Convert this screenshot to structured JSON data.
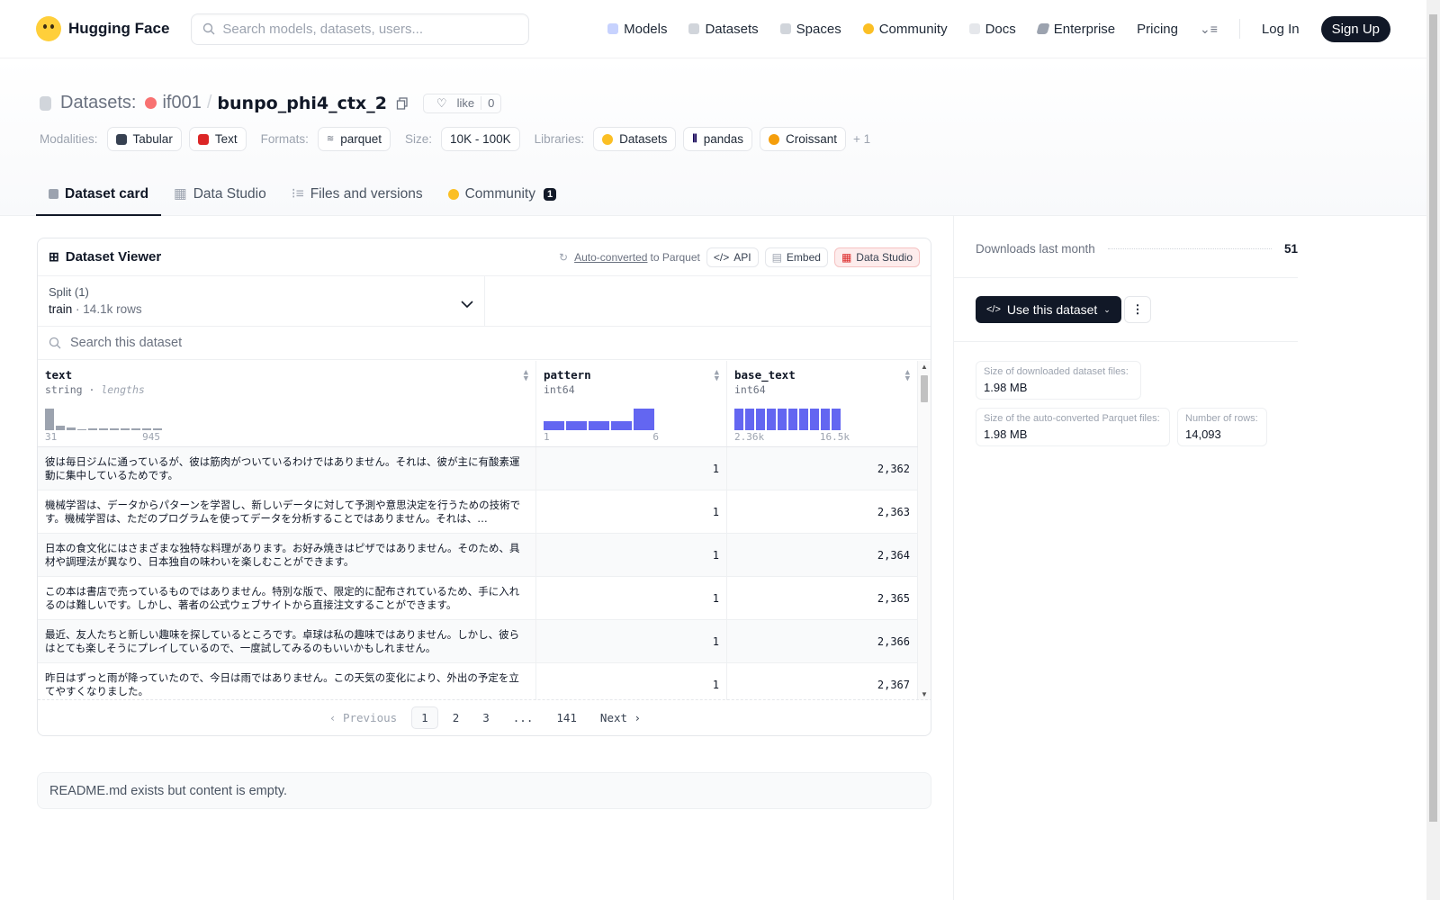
{
  "nav": {
    "brand": "Hugging Face",
    "search_placeholder": "Search models, datasets, users...",
    "links": [
      "Models",
      "Datasets",
      "Spaces",
      "Community",
      "Docs",
      "Enterprise",
      "Pricing"
    ],
    "login": "Log In",
    "signup": "Sign Up"
  },
  "header": {
    "section": "Datasets:",
    "owner": "if001",
    "slash": "/",
    "repo": "bunpo_phi4_ctx_2",
    "like_label": "like",
    "like_count": "0",
    "modalities_label": "Modalities:",
    "modalities": [
      "Tabular",
      "Text"
    ],
    "formats_label": "Formats:",
    "formats": [
      "parquet"
    ],
    "size_label": "Size:",
    "size": "10K - 100K",
    "libraries_label": "Libraries:",
    "libraries": [
      "Datasets",
      "pandas",
      "Croissant"
    ],
    "libraries_more": "+ 1"
  },
  "tabs": [
    {
      "label": "Dataset card"
    },
    {
      "label": "Data Studio"
    },
    {
      "label": "Files and versions"
    },
    {
      "label": "Community",
      "badge": "1"
    }
  ],
  "viewer": {
    "title": "Dataset Viewer",
    "auto_converted": "Auto-converted",
    "to_parquet": "to Parquet",
    "api": "API",
    "embed": "Embed",
    "data_studio": "Data Studio",
    "split_label": "Split (1)",
    "split_name": "train",
    "split_dot": "·",
    "split_rows": "14.1k rows",
    "search_placeholder": "Search this dataset",
    "columns": [
      {
        "name": "text",
        "type": "string",
        "sub": "lengths",
        "min": "31",
        "max": "945"
      },
      {
        "name": "pattern",
        "type": "int64",
        "min": "1",
        "max": "6"
      },
      {
        "name": "base_text",
        "type": "int64",
        "min": "2.36k",
        "max": "16.5k"
      }
    ],
    "rows": [
      {
        "text": "彼は毎日ジムに通っているが、彼は筋肉がついているわけではありません。それは、彼が主に有酸素運動に集中しているためです。",
        "pattern": "1",
        "base_text": "2,362"
      },
      {
        "text": "機械学習は、データからパターンを学習し、新しいデータに対して予測や意思決定を行うための技術です。機械学習は、ただのプログラムを使ってデータを分析することではありません。それは、…",
        "pattern": "1",
        "base_text": "2,363"
      },
      {
        "text": "日本の食文化にはさまざまな独特な料理があります。お好み焼きはピザではありません。そのため、具材や調理法が異なり、日本独自の味わいを楽しむことができます。",
        "pattern": "1",
        "base_text": "2,364"
      },
      {
        "text": "この本は書店で売っているものではありません。特別な版で、限定的に配布されているため、手に入れるのは難しいです。しかし、著者の公式ウェブサイトから直接注文することができます。",
        "pattern": "1",
        "base_text": "2,365"
      },
      {
        "text": "最近、友人たちと新しい趣味を探しているところです。卓球は私の趣味ではありません。しかし、彼らはとても楽しそうにプレイしているので、一度試してみるのもいいかもしれません。",
        "pattern": "1",
        "base_text": "2,366"
      },
      {
        "text": "昨日はずっと雨が降っていたので、今日は雨ではありません。この天気の変化により、外出の予定を立てやすくなりました。",
        "pattern": "1",
        "base_text": "2,367"
      }
    ],
    "pager": {
      "prev": "Previous",
      "pages": [
        "1",
        "2",
        "3",
        "...",
        "141"
      ],
      "next": "Next"
    }
  },
  "readme": "README.md exists but content is empty.",
  "sidebar": {
    "downloads_label": "Downloads last month",
    "downloads": "51",
    "use_button": "Use this dataset",
    "dl_size_label": "Size of downloaded dataset files:",
    "dl_size": "1.98 MB",
    "pq_size_label": "Size of the auto-converted Parquet files:",
    "pq_size": "1.98 MB",
    "rows_label": "Number of rows:",
    "rows": "14,093"
  },
  "histograms": {
    "text": [
      14,
      3,
      2,
      0,
      1,
      1,
      1,
      1,
      1,
      1,
      1
    ],
    "pattern": [
      3,
      3,
      3,
      3,
      7
    ],
    "base_text": [
      6,
      6,
      6,
      6,
      6,
      6,
      6,
      6,
      6,
      6
    ]
  },
  "colors": {
    "accent": "#6366f1",
    "dark": "#111827"
  }
}
